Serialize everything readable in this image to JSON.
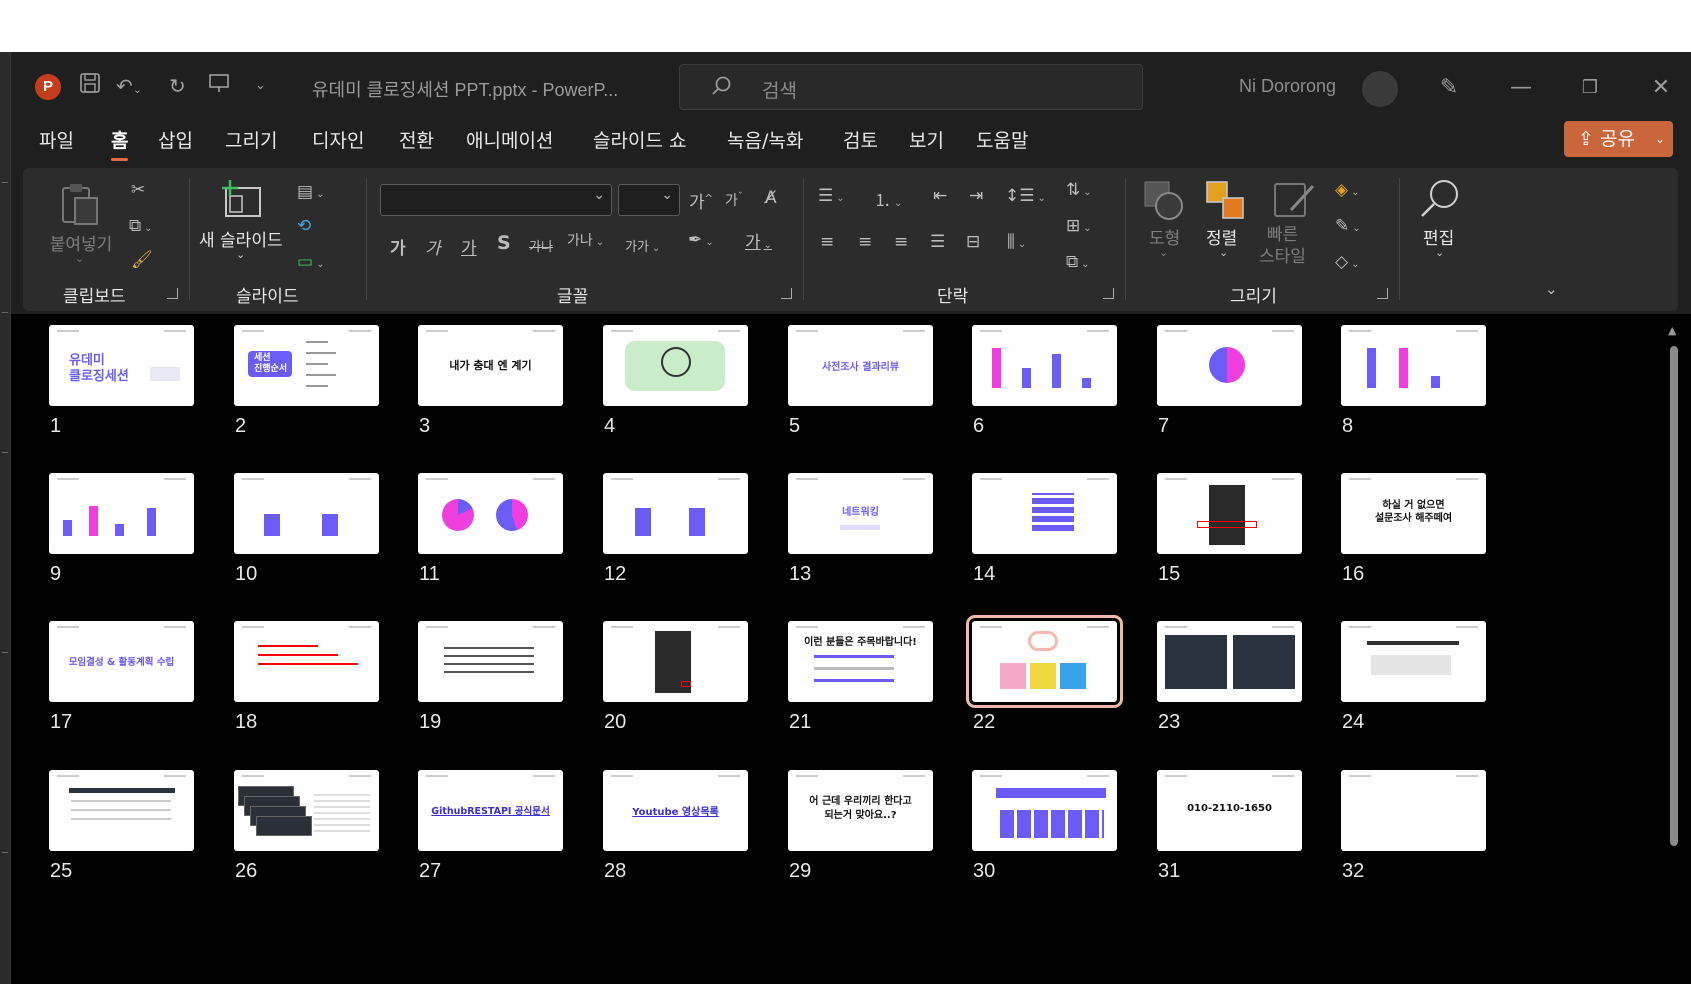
{
  "window": {
    "app_logo": "P",
    "document_title": "유데미 클로징세션 PPT.pptx  -  PowerP...",
    "search_placeholder": "검색",
    "user_name": "Ni Dororong"
  },
  "menu": {
    "items": [
      "파일",
      "홈",
      "삽입",
      "그리기",
      "디자인",
      "전환",
      "애니메이션",
      "슬라이드 쇼",
      "녹음/녹화",
      "검토",
      "보기",
      "도움말"
    ],
    "active": "홈",
    "share_label": "공유"
  },
  "ribbon": {
    "clipboard": {
      "paste_label": "붙여넣기",
      "group_label": "클립보드"
    },
    "slides": {
      "new_slide_label": "새 슬라이드",
      "group_label": "슬라이드"
    },
    "font": {
      "group_label": "글꼴",
      "grow": "가",
      "shrink": "가",
      "bold": "가",
      "italic": "가",
      "underline": "가",
      "shadow": "S",
      "strike": "가나",
      "spacing": "가나",
      "case": "가가",
      "color": "가"
    },
    "paragraph": {
      "group_label": "단락"
    },
    "drawing": {
      "shapes_label": "도형",
      "arrange_label": "정렬",
      "quick_styles_label": "빠른\n스타일",
      "group_label": "그리기"
    },
    "editing": {
      "label": "편집"
    }
  },
  "slides": [
    {
      "num": "1",
      "text": "유데미\n클로징세션"
    },
    {
      "num": "2",
      "text": "세션\n진행순서"
    },
    {
      "num": "3",
      "text": "내가 충대 엔 계기"
    },
    {
      "num": "4",
      "text": ""
    },
    {
      "num": "5",
      "text": "사전조사 결과리뷰"
    },
    {
      "num": "6",
      "text": ""
    },
    {
      "num": "7",
      "text": ""
    },
    {
      "num": "8",
      "text": ""
    },
    {
      "num": "9",
      "text": ""
    },
    {
      "num": "10",
      "text": ""
    },
    {
      "num": "11",
      "text": ""
    },
    {
      "num": "12",
      "text": ""
    },
    {
      "num": "13",
      "text": "네트워킹"
    },
    {
      "num": "14",
      "text": ""
    },
    {
      "num": "15",
      "text": ""
    },
    {
      "num": "16",
      "text": "하실 거 없으면\n설문조사 해주떼여"
    },
    {
      "num": "17",
      "text": "모임결성 & 활동계획 수립"
    },
    {
      "num": "18",
      "text": ""
    },
    {
      "num": "19",
      "text": ""
    },
    {
      "num": "20",
      "text": ""
    },
    {
      "num": "21",
      "text": "이런 분들은 주목바랍니다!"
    },
    {
      "num": "22",
      "text": ""
    },
    {
      "num": "23",
      "text": ""
    },
    {
      "num": "24",
      "text": ""
    },
    {
      "num": "25",
      "text": ""
    },
    {
      "num": "26",
      "text": ""
    },
    {
      "num": "27",
      "text": "GithubRESTAPI 공식문서"
    },
    {
      "num": "28",
      "text": "Youtube 영상목록"
    },
    {
      "num": "29",
      "text": "어 근데 우리끼리 한다고\n되는거 맞아요..?"
    },
    {
      "num": "30",
      "text": ""
    },
    {
      "num": "31",
      "text": "010-2110-1650"
    },
    {
      "num": "32",
      "text": ""
    }
  ],
  "selected_slide": "22",
  "colors": {
    "accent": "#e06b43",
    "share": "#c9663c",
    "purple": "#6b5cf5",
    "pink": "#f03ee0",
    "selection": "#f0b9a6"
  }
}
